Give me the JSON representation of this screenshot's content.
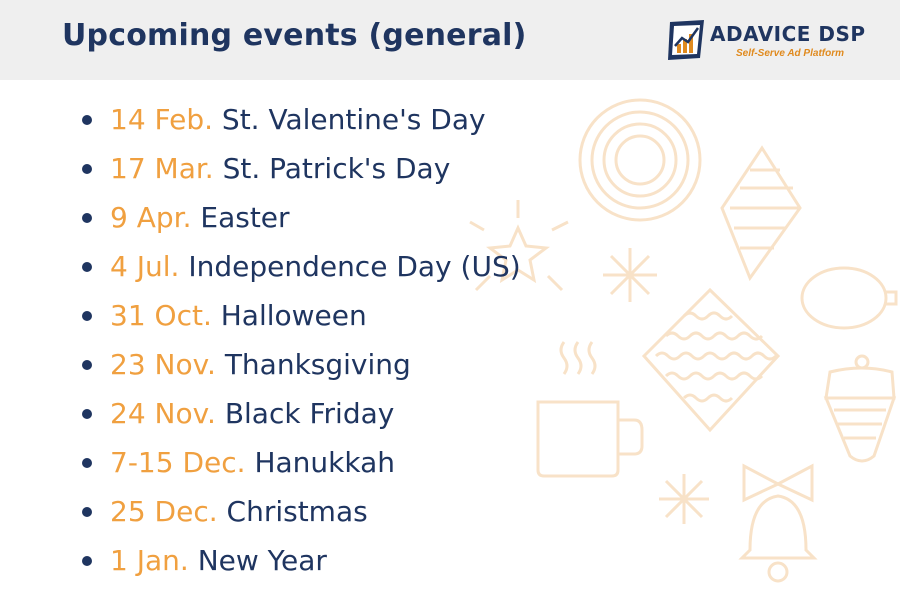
{
  "header": {
    "title": "Upcoming events (general)",
    "logo_name": "ADAVICE DSP",
    "logo_tagline": "Self-Serve Ad Platform"
  },
  "events": [
    {
      "date": "14 Feb.",
      "name": "St. Valentine's Day"
    },
    {
      "date": "17 Mar.",
      "name": "St. Patrick's Day"
    },
    {
      "date": "9 Apr.",
      "name": "Easter"
    },
    {
      "date": "4 Jul.",
      "name": "Independence Day (US)"
    },
    {
      "date": "31 Oct.",
      "name": "Halloween"
    },
    {
      "date": "23 Nov.",
      "name": "Thanksgiving"
    },
    {
      "date": "24 Nov.",
      "name": "Black Friday"
    },
    {
      "date": "7-15 Dec.",
      "name": "Hanukkah"
    },
    {
      "date": "25 Dec.",
      "name": "Christmas"
    },
    {
      "date": "1 Jan.",
      "name": "New Year"
    }
  ],
  "decorations": [
    "concentric-ornament-icon",
    "striped-ornament-icon",
    "star-icon",
    "snowflake-icon",
    "round-ornament-icon",
    "wavy-ornament-icon",
    "coffee-mug-icon",
    "acorn-ornament-icon",
    "bow-icon",
    "bell-icon"
  ],
  "colors": {
    "navy": "#1f3560",
    "orange": "#f0a040",
    "decoration": "#f8e2c8",
    "header_bg": "#efefef"
  }
}
